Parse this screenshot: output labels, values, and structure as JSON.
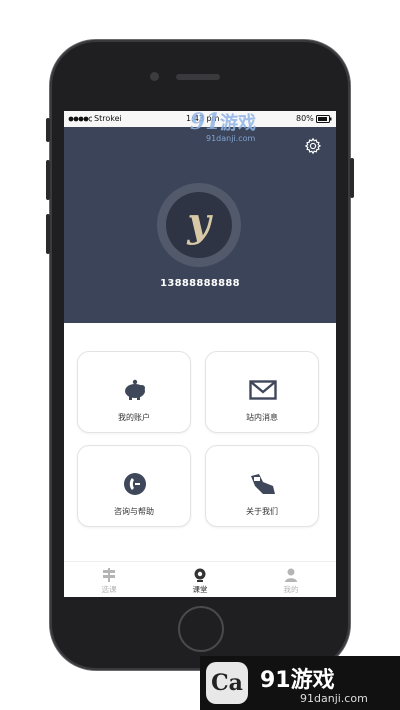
{
  "status_bar": {
    "carrier": "Strokei",
    "time": "1:43 pm",
    "battery": "80%"
  },
  "profile": {
    "avatar_letter": "y",
    "phone_number": "13888888888"
  },
  "menu": [
    {
      "label": "我的账户",
      "icon": "piggy-bank-icon"
    },
    {
      "label": "站内消息",
      "icon": "envelope-icon"
    },
    {
      "label": "咨询与帮助",
      "icon": "phone-call-icon"
    },
    {
      "label": "关于我们",
      "icon": "hand-card-icon"
    }
  ],
  "tabbar": [
    {
      "label": "选课",
      "icon": "signpost-icon",
      "active": false
    },
    {
      "label": "课堂",
      "icon": "webcam-icon",
      "active": true
    },
    {
      "label": "我的",
      "icon": "person-icon",
      "active": false
    }
  ],
  "watermark": {
    "brand": "游戏",
    "brand_number": "91",
    "site": "91danji.com"
  },
  "colors": {
    "header": "#3b4458",
    "icon": "#3f475a",
    "tab_inactive": "#b5b5b5",
    "tab_active": "#333333"
  }
}
